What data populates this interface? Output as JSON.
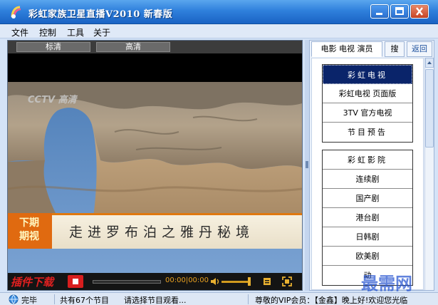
{
  "window": {
    "title": "彩虹家族卫星直播V2010 新春版",
    "icon": "rainbow-logo-icon"
  },
  "menu": [
    "文件",
    "控制",
    "工具",
    "关于"
  ],
  "player": {
    "quality_buttons": [
      "标清",
      "高清"
    ],
    "channel_logo": "CCTV 高清",
    "caption_tag": "下期 期视",
    "caption": "走进罗布泊之雅丹秘境",
    "plugin_download": "插件下载",
    "time": "00:00|00:00",
    "volume_level": 0.9,
    "progress": 0
  },
  "sidebar": {
    "tab_main": "电影 电视 演员",
    "tab_search": "搜",
    "tab_back": "返回",
    "group_tv": {
      "items": [
        {
          "label": "彩虹电视",
          "selected": true
        },
        {
          "label": "彩虹电视 页面版"
        },
        {
          "label": "3TV 官方电视"
        },
        {
          "label": "节目预告"
        }
      ]
    },
    "group_cinema": {
      "items": [
        {
          "label": "彩虹影院"
        },
        {
          "label": "连续剧"
        },
        {
          "label": "国产剧"
        },
        {
          "label": "港台剧"
        },
        {
          "label": "日韩剧"
        },
        {
          "label": "欧美剧"
        },
        {
          "label": "动"
        }
      ]
    }
  },
  "watermark": "最需网",
  "status": {
    "state": "完毕",
    "program_count": "共有67个节目",
    "hint": "请选择节目观看...",
    "vip_message": "尊敬的VIP会员：【金鑫】晚上好!欢迎您光临"
  }
}
